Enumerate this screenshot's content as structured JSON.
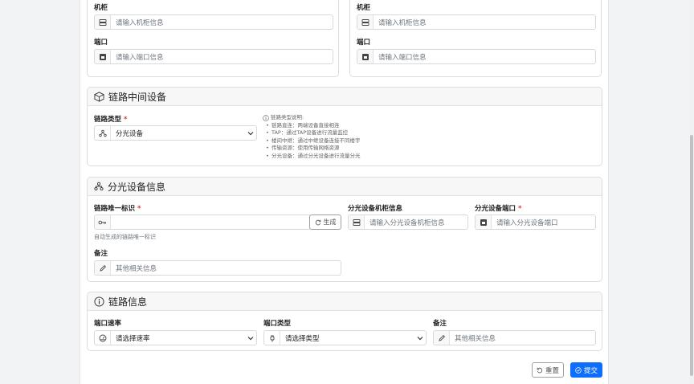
{
  "endpoint_a": {
    "cabinet_label": "机柜",
    "cabinet_placeholder": "请输入机柜信息",
    "port_label": "端口",
    "port_placeholder": "请输入端口信息"
  },
  "endpoint_b": {
    "cabinet_label": "机柜",
    "cabinet_placeholder": "请输入机柜信息",
    "port_label": "端口",
    "port_placeholder": "请输入端口信息"
  },
  "middle_device": {
    "title": "链路中间设备",
    "type_label": "链路类型",
    "required_mark": "*",
    "type_value": "分光设备",
    "hint_title": "链路类型说明:",
    "hints": [
      "链路直连：两端设备直接相连",
      "TAP：通过TAP设备进行流量监控",
      "楼间中继：通过中继设备连接不同楼宇",
      "传输资源：使用传输网络资源",
      "分光设备：通过分光设备进行流量分光"
    ]
  },
  "splitter": {
    "title": "分光设备信息",
    "uid_label": "链路唯一标识",
    "required_mark": "*",
    "uid_value": "",
    "generate_label": "生成",
    "uid_help": "自动生成的链路唯一标识",
    "cabinet_label": "分光设备机柜信息",
    "cabinet_placeholder": "请输入分光设备机柜信息",
    "port_label": "分光设备端口",
    "port_placeholder": "请输入分光设备端口",
    "remark_label": "备注",
    "remark_placeholder": "其他相关信息"
  },
  "link_info": {
    "title": "链路信息",
    "rate_label": "端口速率",
    "rate_placeholder": "请选择速率",
    "port_type_label": "端口类型",
    "port_type_placeholder": "请选择类型",
    "remark_label": "备注",
    "remark_placeholder": "其他相关信息"
  },
  "actions": {
    "reset_label": "重置",
    "submit_label": "提交"
  },
  "colors": {
    "primary": "#0d6efd",
    "required": "#dc3545"
  }
}
